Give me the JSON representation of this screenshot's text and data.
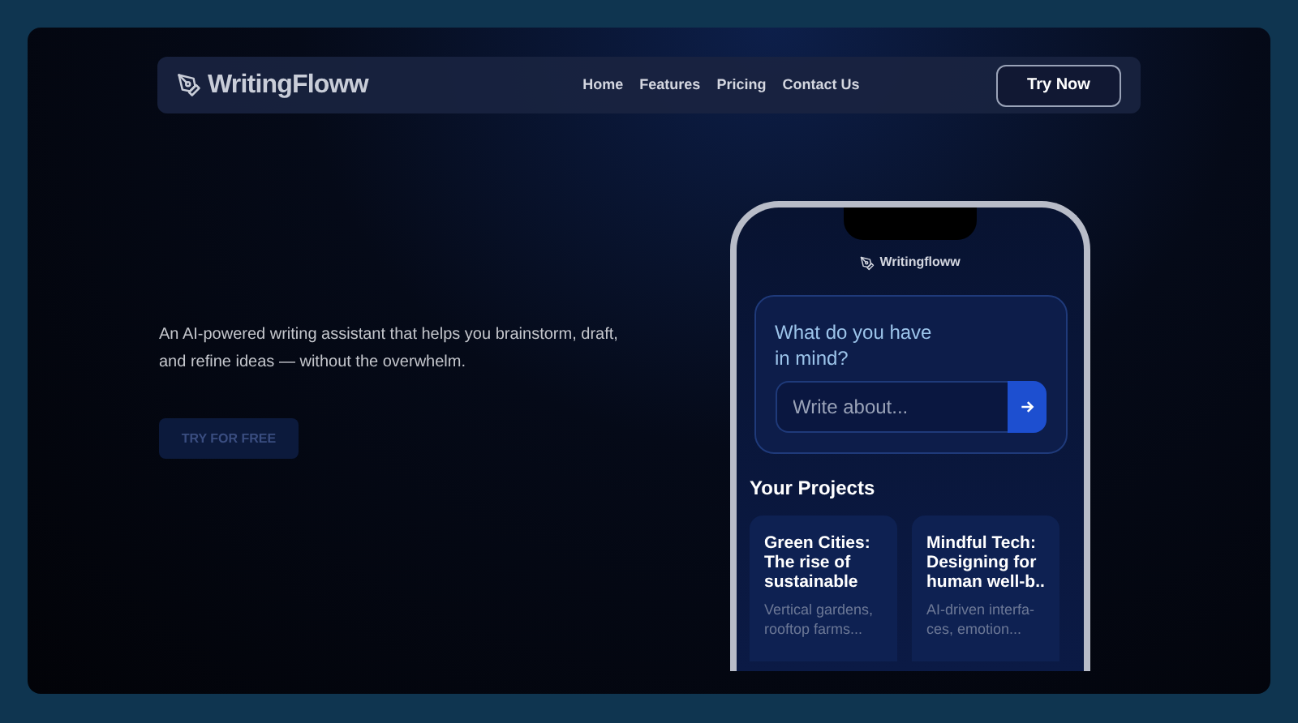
{
  "nav": {
    "logo": "WritingFloww",
    "links": [
      "Home",
      "Features",
      "Pricing",
      "Contact Us"
    ],
    "cta": "Try Now"
  },
  "hero": {
    "description": "An AI-powered writing assistant that helps you brainstorm, draft, and refine ideas — without the overwhelm.",
    "cta": "TRY FOR FREE"
  },
  "phone": {
    "app_name": "Writingfloww",
    "prompt_title": "What do you have in mind?",
    "input_placeholder": "Write about...",
    "section_title": "Your Projects",
    "projects": [
      {
        "title": "Green Cities: The rise of sustainable",
        "excerpt": "Vertical gardens, rooftop farms..."
      },
      {
        "title": "Mindful Tech: Designing for human well-b..",
        "excerpt": "AI-driven interfa-ces, emotion..."
      }
    ]
  }
}
